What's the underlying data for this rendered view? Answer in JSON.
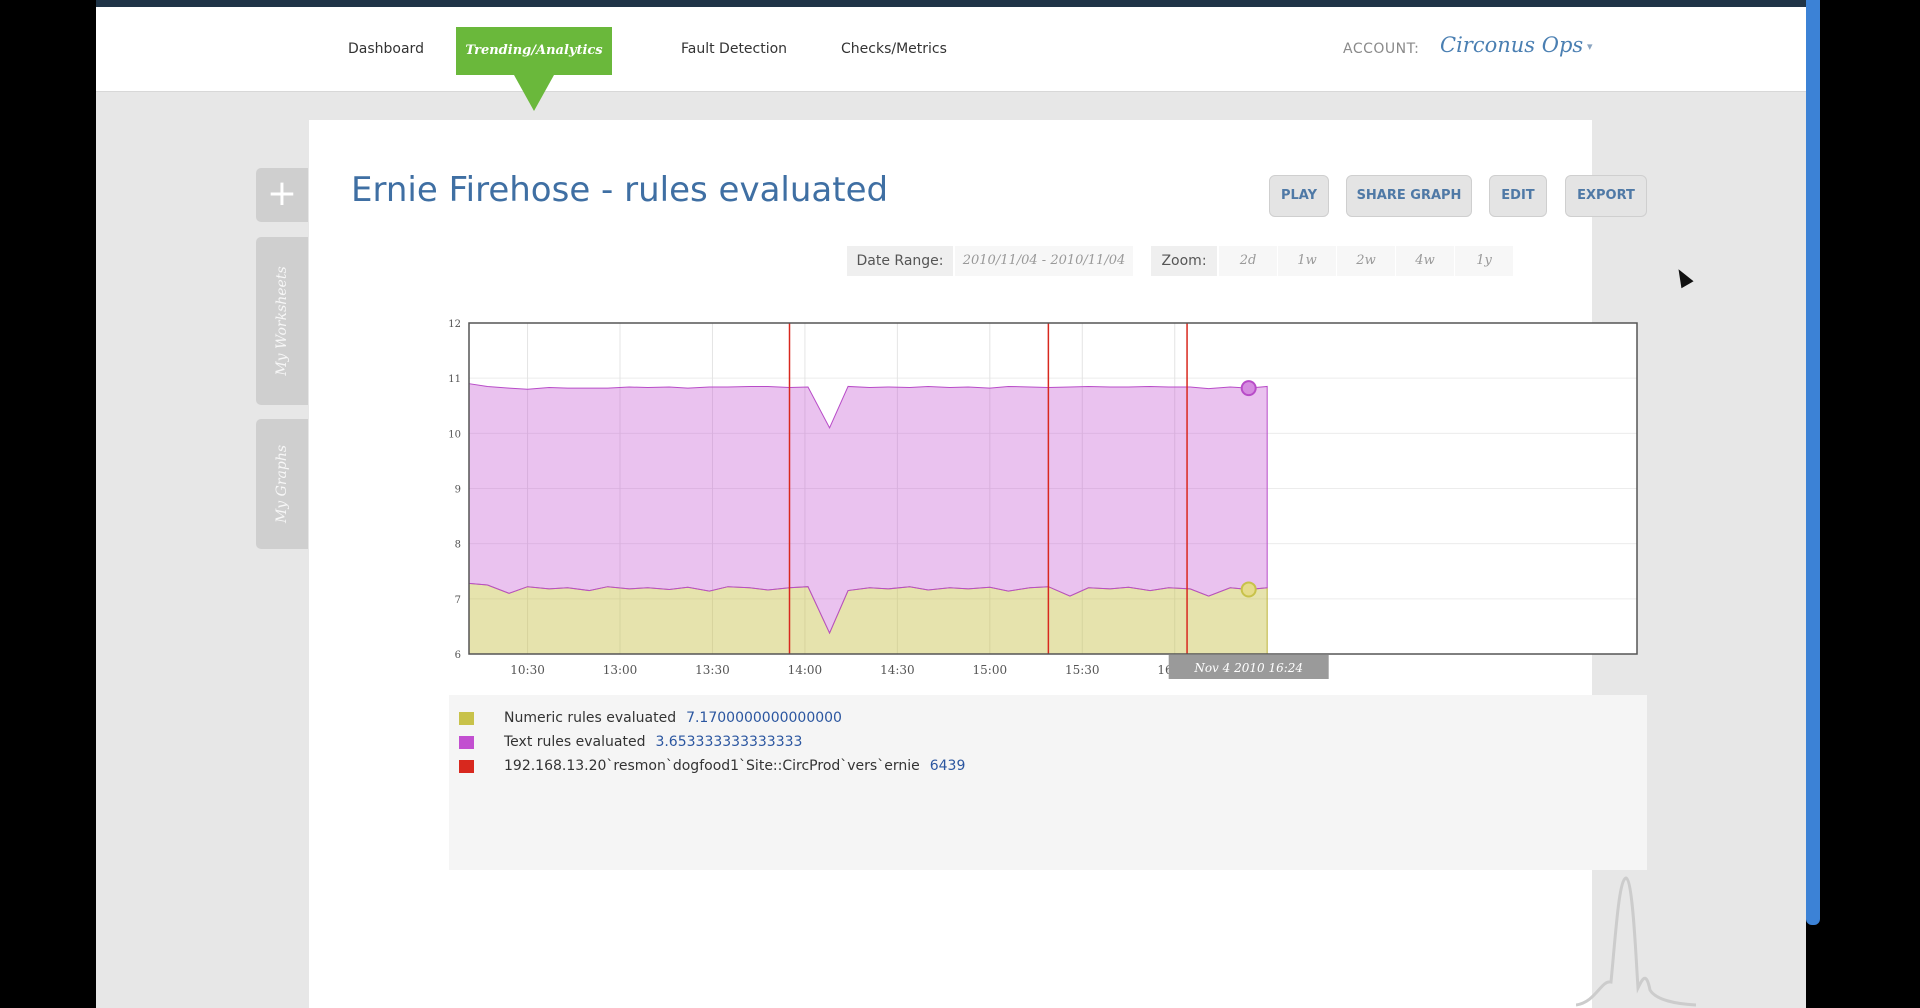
{
  "nav": {
    "tabs": [
      {
        "label": "Dashboard"
      },
      {
        "label": "Trending/Analytics"
      },
      {
        "label": "Fault Detection"
      },
      {
        "label": "Checks/Metrics"
      }
    ],
    "account_label": "ACCOUNT:",
    "account_name": "Circonus Ops"
  },
  "sidebar": {
    "plus": "+",
    "worksheets": "My Worksheets",
    "graphs": "My Graphs"
  },
  "graph": {
    "title": "Ernie Firehose - rules evaluated",
    "buttons": {
      "play": "PLAY",
      "share": "SHARE GRAPH",
      "edit": "EDIT",
      "export": "EXPORT"
    },
    "date_range_label": "Date Range:",
    "date_range_value": "2010/11/04 - 2010/11/04",
    "zoom_label": "Zoom:",
    "zoom_options": [
      "2d",
      "1w",
      "2w",
      "4w",
      "1y"
    ]
  },
  "colors": {
    "nav_active": "#6ab83b",
    "title": "#3f6fa3",
    "numeric_series": "#c8c24a",
    "text_series": "#c24fd0",
    "event_marker": "#d8281e"
  },
  "chart_data": {
    "type": "area",
    "stacked": true,
    "ylim": [
      6,
      12
    ],
    "yticks": [
      6,
      7,
      8,
      9,
      10,
      11,
      12
    ],
    "xlim": [
      "10:11",
      "16:30"
    ],
    "xticks": [
      {
        "label": "10:30",
        "t": "10:30"
      },
      {
        "label": "13:00",
        "t": "11:00"
      },
      {
        "label": "13:30",
        "t": "11:30"
      },
      {
        "label": "14:00",
        "t": "12:00"
      },
      {
        "label": "14:30",
        "t": "12:30"
      },
      {
        "label": "15:00",
        "t": "13:00"
      },
      {
        "label": "15:30",
        "t": "13:30"
      },
      {
        "label": "16:00",
        "t": "14:00"
      }
    ],
    "x": [
      "10:11",
      "10:17",
      "10:24",
      "10:30",
      "10:37",
      "10:43",
      "10:50",
      "10:56",
      "11:03",
      "11:09",
      "11:16",
      "11:22",
      "11:29",
      "11:35",
      "11:42",
      "11:48",
      "11:55",
      "12:01",
      "12:08",
      "12:14",
      "12:21",
      "12:27",
      "12:34",
      "12:40",
      "12:47",
      "12:53",
      "13:00",
      "13:06",
      "13:13",
      "13:19",
      "13:26",
      "13:32",
      "13:39",
      "13:45",
      "13:52",
      "13:58",
      "14:05",
      "14:11",
      "14:18",
      "14:24",
      "14:30"
    ],
    "series": [
      {
        "name": "Numeric rules evaluated",
        "values": [
          7.28,
          7.25,
          7.1,
          7.22,
          7.18,
          7.2,
          7.15,
          7.22,
          7.18,
          7.2,
          7.17,
          7.21,
          7.14,
          7.22,
          7.2,
          7.16,
          7.2,
          7.22,
          6.38,
          7.15,
          7.2,
          7.18,
          7.22,
          7.16,
          7.2,
          7.18,
          7.21,
          7.14,
          7.2,
          7.22,
          7.05,
          7.2,
          7.18,
          7.21,
          7.15,
          7.2,
          7.18,
          7.05,
          7.2,
          7.17,
          7.2
        ]
      },
      {
        "name": "Text rules evaluated",
        "values": [
          3.62,
          3.6,
          3.72,
          3.58,
          3.65,
          3.62,
          3.67,
          3.6,
          3.66,
          3.63,
          3.67,
          3.61,
          3.7,
          3.62,
          3.65,
          3.69,
          3.63,
          3.62,
          3.72,
          3.7,
          3.63,
          3.66,
          3.61,
          3.69,
          3.63,
          3.66,
          3.61,
          3.71,
          3.64,
          3.61,
          3.79,
          3.65,
          3.66,
          3.63,
          3.7,
          3.64,
          3.66,
          3.76,
          3.64,
          3.65,
          3.65
        ]
      }
    ],
    "event_markers": [
      "11:55",
      "13:19",
      "14:04"
    ],
    "hover": {
      "label": "Nov 4 2010 16:24",
      "t": "14:24"
    }
  },
  "legend": [
    {
      "label": "Numeric rules evaluated",
      "value": "7.1700000000000000",
      "color": "#c8c24a"
    },
    {
      "label": "Text rules evaluated",
      "value": "3.653333333333333",
      "color": "#c24fd0"
    },
    {
      "label": "192.168.13.20`resmon`dogfood1`Site::CircProd`vers`ernie",
      "value": "6439",
      "color": "#d8281e"
    }
  ]
}
